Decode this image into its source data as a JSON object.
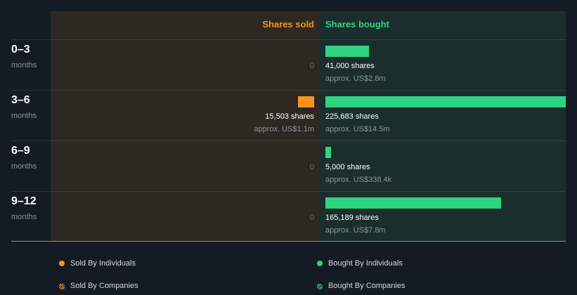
{
  "chart_data": {
    "type": "bar",
    "orientation": "horizontal",
    "headers": {
      "sold": "Shares sold",
      "bought": "Shares bought"
    },
    "categories": [
      "0–3",
      "3–6",
      "6–9",
      "9–12"
    ],
    "category_unit": "months",
    "series": [
      {
        "name": "Shares sold",
        "values": [
          0,
          15503,
          0,
          0
        ],
        "value_labels": [
          "0",
          "15,503 shares",
          "0",
          "0"
        ],
        "approx_labels": [
          "",
          "approx. US$1.1m",
          "",
          ""
        ]
      },
      {
        "name": "Shares bought",
        "values": [
          41000,
          225683,
          5000,
          165189
        ],
        "value_labels": [
          "41,000 shares",
          "225,683 shares",
          "5,000 shares",
          "165,189 shares"
        ],
        "approx_labels": [
          "approx. US$2.8m",
          "approx. US$14.5m",
          "approx. US$338.4k",
          "approx. US$7.8m"
        ]
      }
    ],
    "legend": [
      {
        "label": "Sold By Individuals",
        "marker": "dot",
        "color": "#f7931e"
      },
      {
        "label": "Bought By Individuals",
        "marker": "dot",
        "color": "#2ed480"
      },
      {
        "label": "Sold By Companies",
        "marker": "hatch",
        "color": "#f7931e"
      },
      {
        "label": "Bought By Companies",
        "marker": "hatch",
        "color": "#2ed480"
      }
    ],
    "legend_position": "bottom",
    "colors": {
      "sold": "#f7931e",
      "bought": "#2ed480"
    }
  }
}
